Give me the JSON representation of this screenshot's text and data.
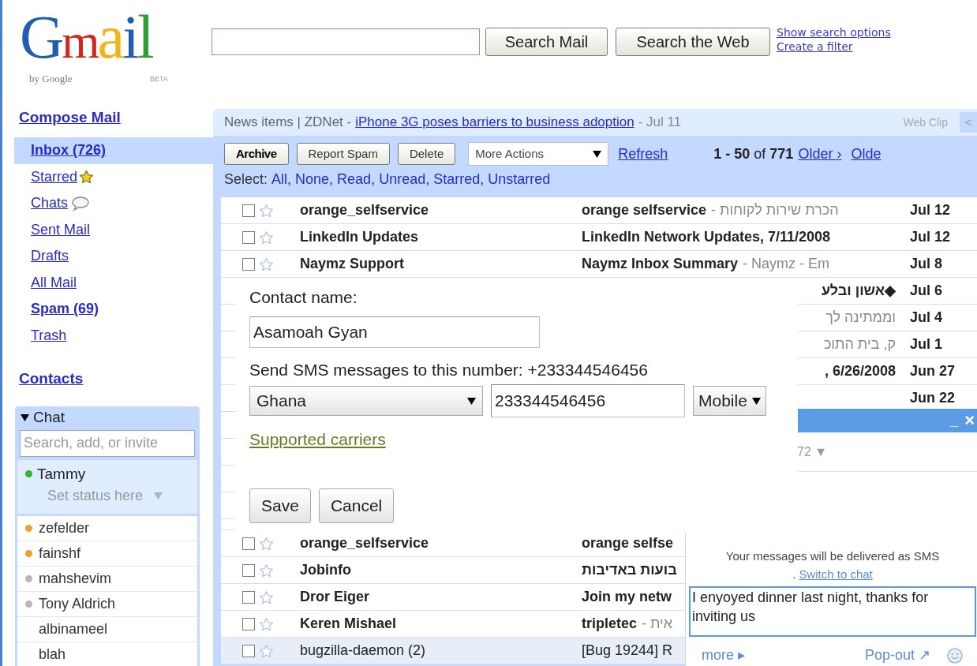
{
  "logo": {
    "wordmark": "Gmail",
    "byline": "by Google",
    "badge": "BETA"
  },
  "search": {
    "buttons": [
      "Search Mail",
      "Search the Web"
    ],
    "links": [
      "Show search options",
      "Create a filter"
    ]
  },
  "compose": "Compose Mail",
  "folders": [
    {
      "label": "Inbox (726)",
      "bold": true,
      "selected": true
    },
    {
      "label": "Starred",
      "bold": false,
      "selected": false,
      "kind": "star"
    },
    {
      "label": "Chats",
      "bold": false,
      "selected": false,
      "kind": "bubble"
    },
    {
      "label": "Sent Mail",
      "bold": false,
      "selected": false
    },
    {
      "label": "Drafts",
      "bold": false,
      "selected": false
    },
    {
      "label": "All Mail",
      "bold": false,
      "selected": false
    },
    {
      "label": "Spam (69)",
      "bold": true,
      "selected": false
    },
    {
      "label": "Trash",
      "bold": false,
      "selected": false
    }
  ],
  "contacts_link": "Contacts",
  "chat_panel": {
    "title": "Chat",
    "expanded": true,
    "search_placeholder": "Search, add, or invite",
    "me": {
      "name": "Tammy",
      "status": "Set status here",
      "color": "#2eb82e"
    },
    "contacts": [
      {
        "name": "zefelder",
        "color": "#f0a030"
      },
      {
        "name": "fainshf",
        "color": "#f0a030"
      },
      {
        "name": "mahshevim",
        "color": "#b8b8b8"
      },
      {
        "name": "Tony Aldrich",
        "color": "#b8b8b8"
      },
      {
        "name": "albinameel"
      },
      {
        "name": "blah"
      }
    ]
  },
  "news": {
    "source": "News items | ZDNet -",
    "headline": "iPhone 3G poses barriers to business adoption",
    "date": "- Jul 11",
    "web_clip": "Web Clip",
    "prev": "<"
  },
  "toolbar": {
    "buttons": [
      {
        "label": "Archive",
        "bold": true
      },
      {
        "label": "Report Spam",
        "bold": false
      },
      {
        "label": "Delete",
        "bold": false
      }
    ],
    "more_actions": "More Actions",
    "refresh": "Refresh",
    "range": "**1 - 50** of **771**",
    "older": "Older ›",
    "oldest": "Olde"
  },
  "select": {
    "label": "Select:",
    "options": [
      "All,",
      "None,",
      "Read,",
      "Unread,",
      "Starred,",
      "Unstarred"
    ]
  },
  "messages": [
    {
      "sender": "orange_selfservice",
      "subject": "orange selfservice",
      "snippet": "- הכרת שירות לקוחות",
      "date": "Jul 12",
      "unread": true,
      "checked": false,
      "starred": false
    },
    {
      "sender": "LinkedIn Updates",
      "subject": "LinkedIn Network Updates, 7/11/2008",
      "date": "Jul 12",
      "unread": true,
      "checked": false,
      "starred": false
    },
    {
      "sender": "Naymz Support",
      "subject": "Naymz Inbox Summary",
      "snippet": "- Naymz - Em",
      "date": "Jul 8",
      "unread": true,
      "checked": false,
      "starred": false
    },
    {
      "subject": "אשון ובלע◆",
      "date": "Jul 6",
      "unread": true
    },
    {
      "snippet": "וממתינה לך",
      "date": "Jul 4",
      "unread": true
    },
    {
      "snippet": "ק, בית התוכ",
      "date": "Jul 1",
      "unread": true
    },
    {
      "subject": ", 6/26/2008",
      "date": "Jun 27",
      "unread": true
    },
    {
      "date": "Jun 22",
      "unread": true
    }
  ],
  "messages_below": [
    {
      "sender": "orange_selfservice",
      "subject": "orange selfse",
      "unread": true,
      "checked": false,
      "starred": false
    },
    {
      "sender": "Jobinfo",
      "subject": "בועות באדיבות",
      "unread": true,
      "checked": false,
      "starred": false
    },
    {
      "sender": "Dror Eiger",
      "subject": "Join my netw",
      "unread": true,
      "checked": false,
      "starred": false
    },
    {
      "sender": "Keren Mishael",
      "subject": "tripletec",
      "snippet": "- אית",
      "unread": true,
      "checked": false,
      "starred": false
    },
    {
      "sender": "bugzilla-daemon (2)",
      "subject": "[Bug 19244] R",
      "unread": false,
      "checked": false,
      "starred": false
    }
  ],
  "sms_dialog": {
    "name_label": "Contact name:",
    "name_value": "Asamoah Gyan",
    "number_label": "Send SMS messages to this number: +233344546456",
    "country": "Ghana",
    "number": "233344546456",
    "phone_type": "Mobile",
    "carriers_link": "Supported carriers",
    "buttons": [
      "Save",
      "Cancel"
    ]
  },
  "chat_window": {
    "minimize": "_",
    "close": "×",
    "contact_fragment": "72 ▼",
    "notice": "Your messages will be delivered as SMS",
    "switch_prefix": ".",
    "switch_link": "Switch to chat",
    "message": "I enyoyed dinner last night, thanks for inviting us",
    "more": "more ▸",
    "popout": "Pop-out ↗"
  }
}
